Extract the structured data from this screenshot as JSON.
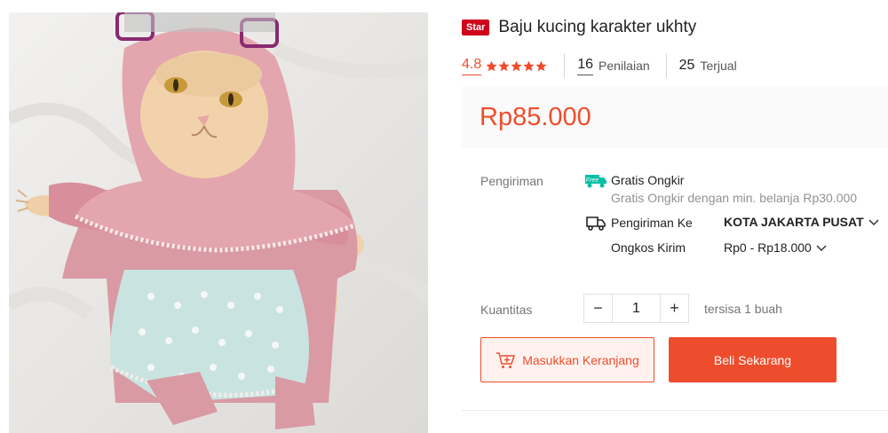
{
  "product": {
    "badge": "Star",
    "title": "Baju kucing karakter ukhty",
    "image_icon": "cat-in-hijab-photo"
  },
  "rating": {
    "value": "4.8",
    "stars": 5,
    "reviews_count": "16",
    "reviews_label": "Penilaian",
    "sold_count": "25",
    "sold_label": "Terjual"
  },
  "price": "Rp85.000",
  "shipping": {
    "label": "Pengiriman",
    "free_icon": "free-shipping-icon",
    "free_icon_text": "Free",
    "free_title": "Gratis Ongkir",
    "free_desc": "Gratis Ongkir dengan min. belanja Rp30.000",
    "to_icon": "truck-icon",
    "to_label": "Pengiriman Ke",
    "to_value": "KOTA JAKARTA PUSAT",
    "cost_label": "Ongkos Kirim",
    "cost_value": "Rp0 - Rp18.000"
  },
  "quantity": {
    "label": "Kuantitas",
    "minus": "−",
    "value": "1",
    "plus": "+",
    "stock": "tersisa 1 buah"
  },
  "actions": {
    "add_to_cart": "Masukkan Keranjang",
    "buy_now": "Beli Sekarang"
  },
  "colors": {
    "accent": "#ee4d2d",
    "badge": "#d0011b",
    "free_icon": "#00bfa5"
  }
}
